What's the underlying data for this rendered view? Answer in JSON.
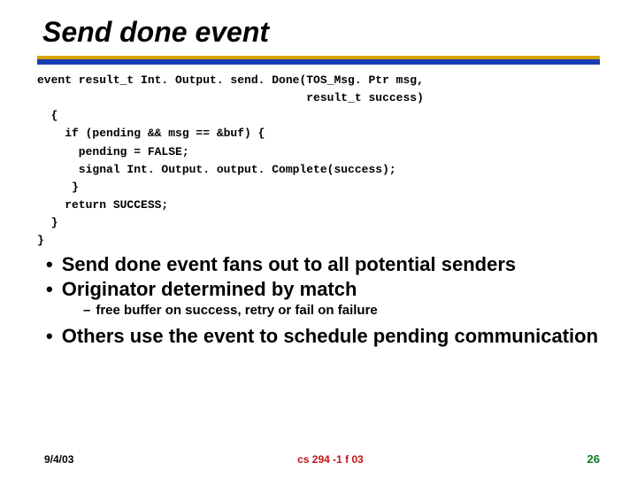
{
  "title": "Send done event",
  "code": "event result_t Int. Output. send. Done(TOS_Msg. Ptr msg,\n                                       result_t success)\n  {\n    if (pending && msg == &buf) {\n      pending = FALSE;\n      signal Int. Output. output. Complete(success);\n     }\n    return SUCCESS;\n  }\n}",
  "bullets": {
    "b1": "Send done event fans out to all potential senders",
    "b2": "Originator determined by match",
    "sub1": "free buffer on success, retry or fail on failure",
    "b3": "Others use the event to schedule pending communication"
  },
  "footer": {
    "date": "9/4/03",
    "center": "cs 294 -1 f 03",
    "page": "26"
  }
}
